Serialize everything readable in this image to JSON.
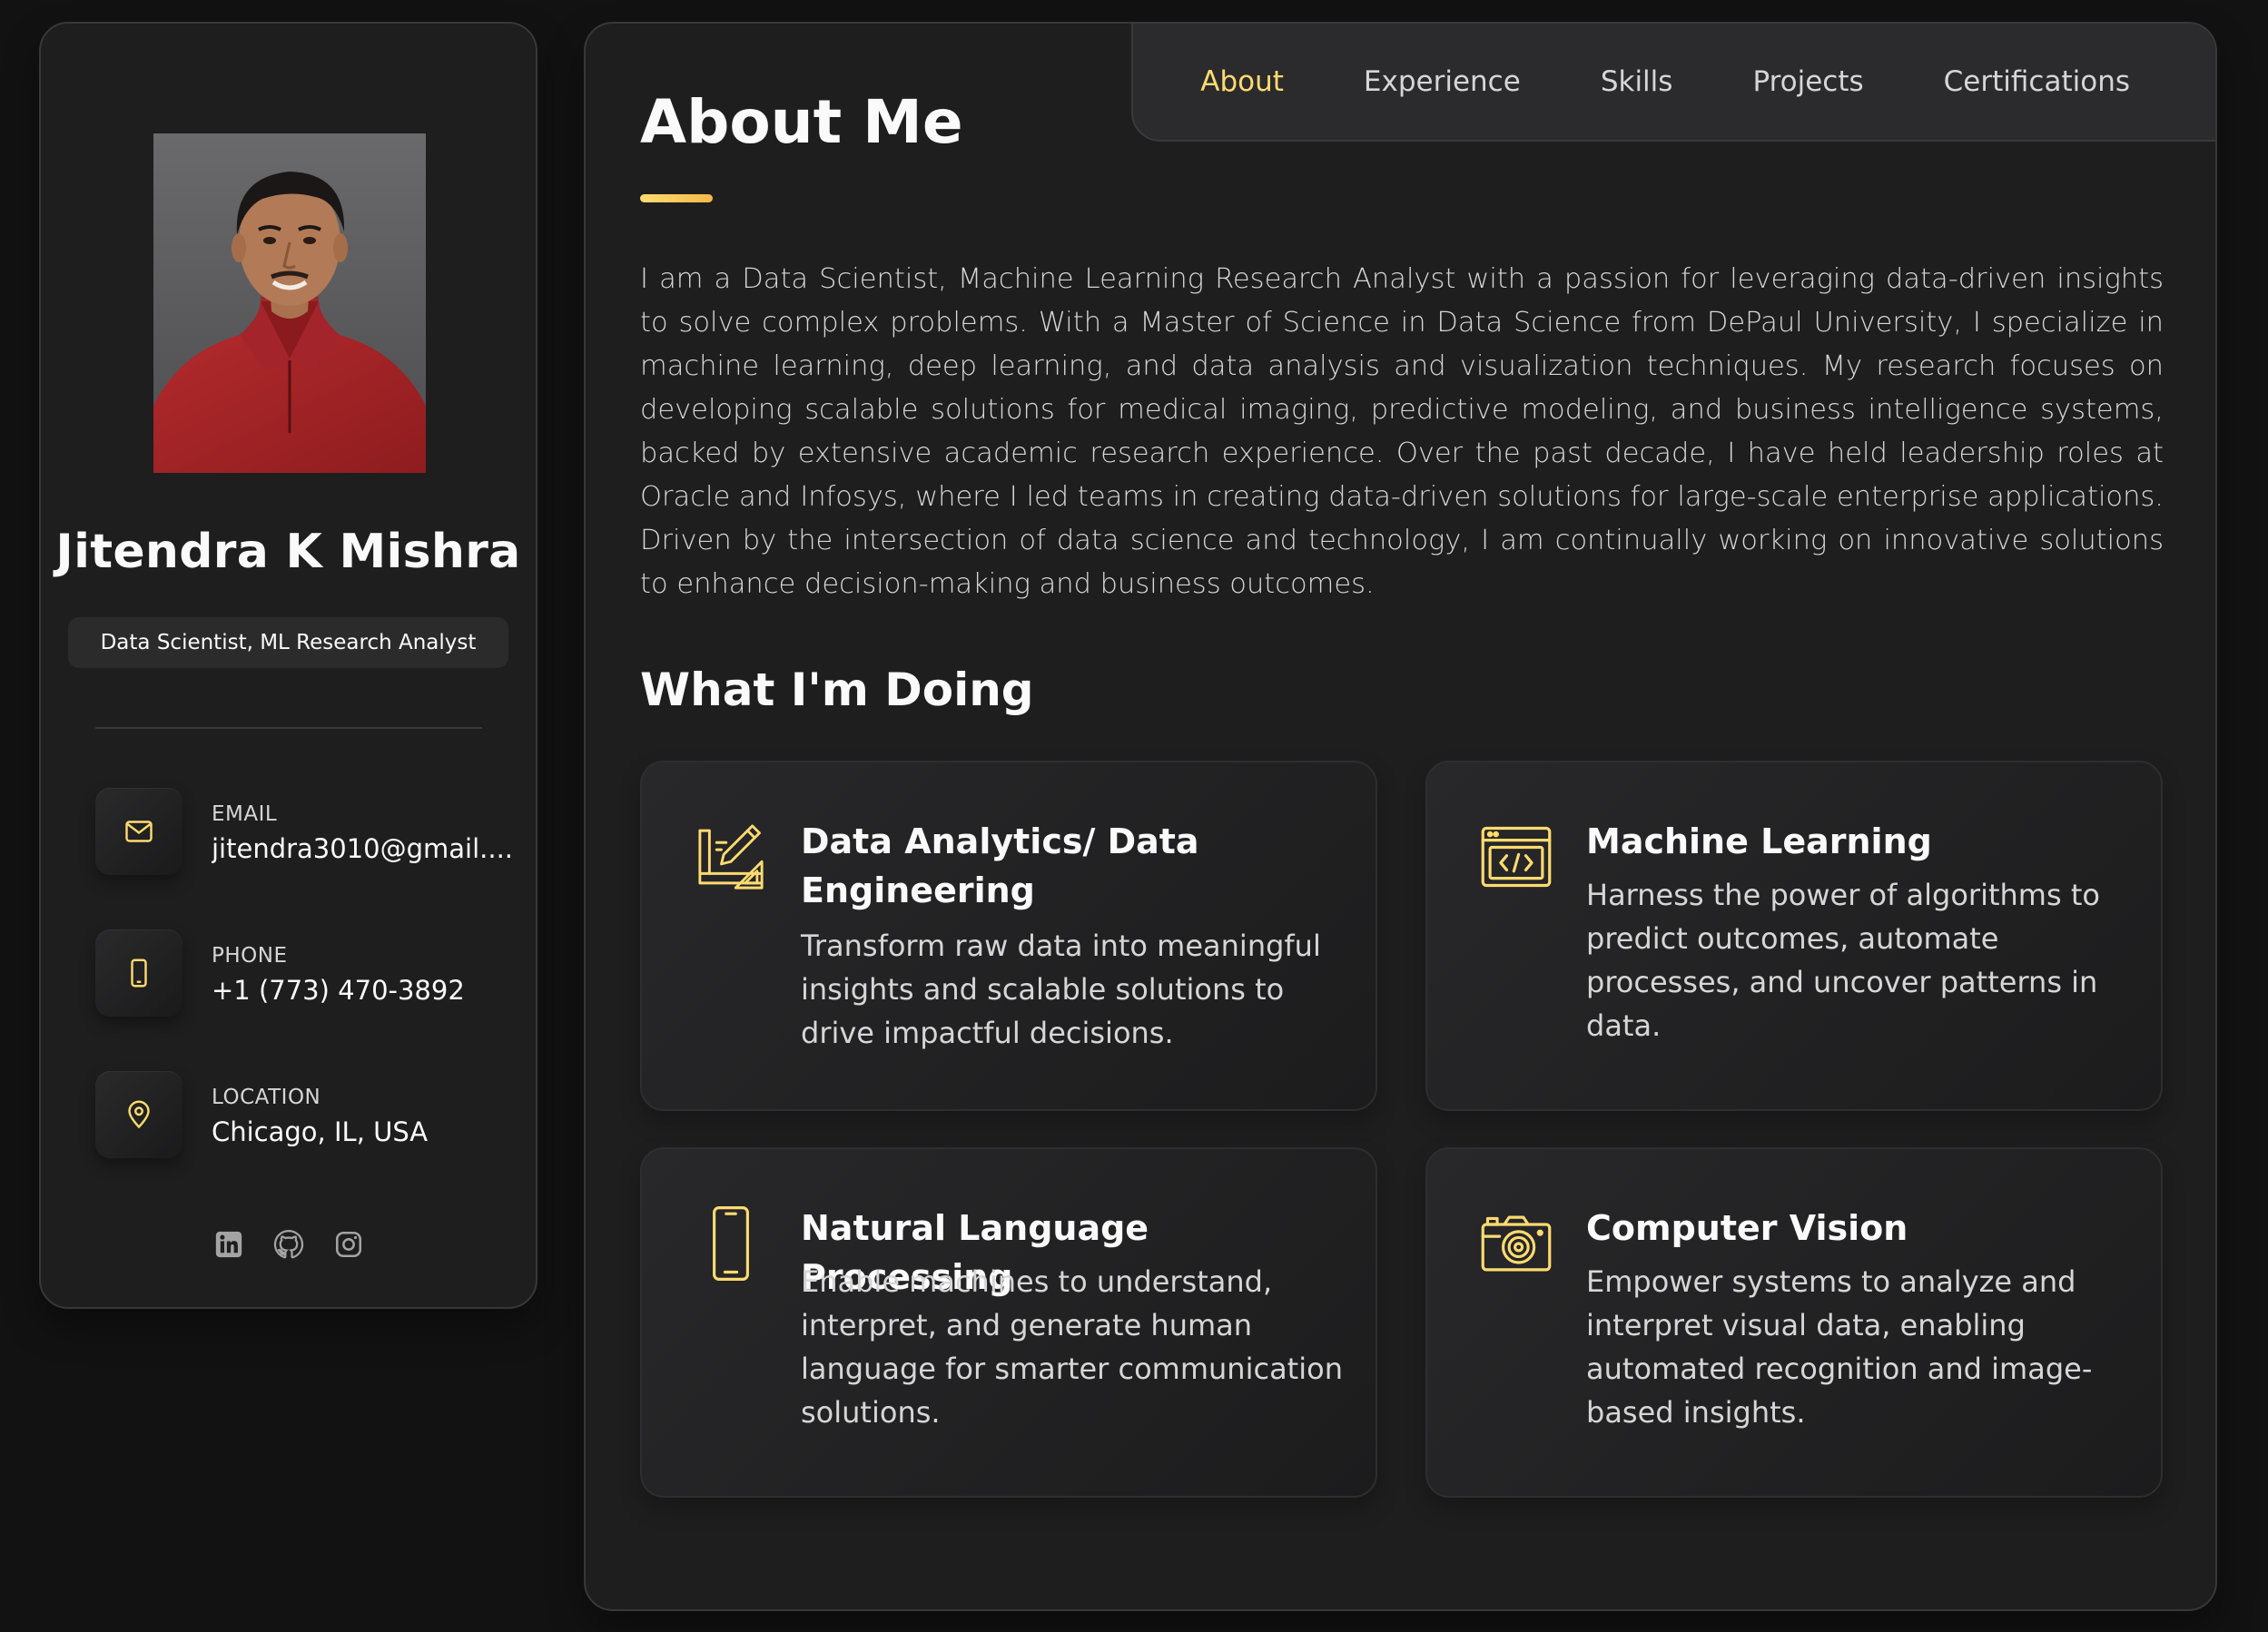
{
  "colors": {
    "background": "#121212",
    "panel": "#1e1e1f",
    "accent": "#ffdb70",
    "text_primary": "#fafafa",
    "text_secondary": "#d6d6d6"
  },
  "profile": {
    "name": "Jitendra K Mishra",
    "title": "Data Scientist, ML Research Analyst",
    "avatar_alt": "Jitendra K Mishra"
  },
  "contacts": [
    {
      "label": "EMAIL",
      "value": "jitendra3010@gmail....",
      "icon": "mail-icon"
    },
    {
      "label": "PHONE",
      "value": "+1 (773) 470-3892",
      "icon": "phone-icon"
    },
    {
      "label": "LOCATION",
      "value": "Chicago, IL, USA",
      "icon": "location-pin-icon"
    }
  ],
  "socials": [
    "linkedin-icon",
    "github-icon",
    "instagram-icon"
  ],
  "nav": {
    "items": [
      "About",
      "Experience",
      "Skills",
      "Projects",
      "Certifications"
    ],
    "active": "About"
  },
  "about": {
    "heading": "About Me",
    "paragraph": "I am a Data Scientist, Machine Learning Research Analyst with a passion for leveraging data-driven insights to solve complex problems. With a Master of Science in Data Science from DePaul University, I specialize in machine learning, deep learning, and data analysis and visualization techniques. My research focuses on developing scalable solutions for medical imaging, predictive modeling, and business intelligence systems, backed by extensive academic research experience. Over the past decade, I have held leadership roles at Oracle and Infosys, where I led teams in creating data-driven solutions for large-scale enterprise applications. Driven by the intersection of data science and technology, I am continually working on innovative solutions to enhance decision-making and business outcomes."
  },
  "services": {
    "heading": "What I'm Doing",
    "items": [
      {
        "title": "Data Analytics/ Data Engineering",
        "text": "Transform raw data into meaningful insights and scalable solutions to drive impactful decisions.",
        "icon": "design-tools-icon"
      },
      {
        "title": "Machine Learning",
        "text": "Harness the power of algorithms to predict outcomes, automate processes, and uncover patterns in data.",
        "icon": "code-window-icon"
      },
      {
        "title": "Natural Language Processing",
        "text": "Enable machines to understand, interpret, and generate human language for smarter communication solutions.",
        "icon": "smartphone-icon"
      },
      {
        "title": "Computer Vision",
        "text": "Empower systems to analyze and interpret visual data, enabling automated recognition and image-based insights.",
        "icon": "camera-icon"
      }
    ]
  }
}
